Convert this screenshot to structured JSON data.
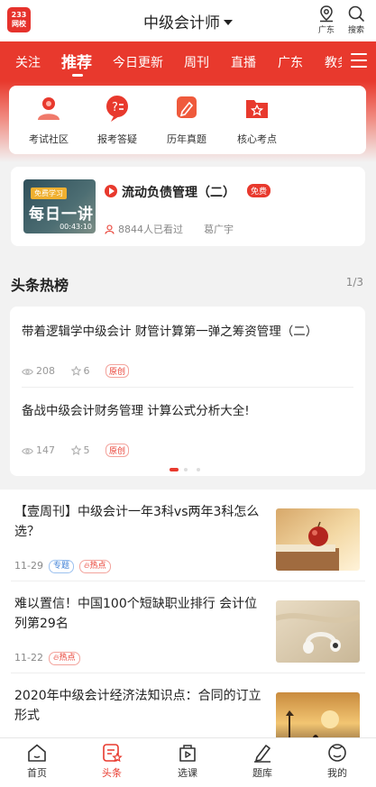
{
  "header": {
    "logo_top": "233",
    "logo_bottom": "网校",
    "title": "中级会计师",
    "location_label": "广东",
    "search_label": "搜索"
  },
  "tabs": [
    {
      "label": "关注"
    },
    {
      "label": "推荐",
      "active": true
    },
    {
      "label": "今日更新"
    },
    {
      "label": "周刊"
    },
    {
      "label": "直播"
    },
    {
      "label": "广东"
    },
    {
      "label": "教务"
    }
  ],
  "quick_entries": [
    {
      "label": "考试社区",
      "icon": "community-icon"
    },
    {
      "label": "报考答疑",
      "icon": "qa-icon"
    },
    {
      "label": "历年真题",
      "icon": "past-papers-icon"
    },
    {
      "label": "核心考点",
      "icon": "key-points-icon"
    }
  ],
  "course": {
    "thumb_tag": "免费学习",
    "thumb_text": "每日一讲",
    "duration": "00:43:10",
    "title": "流动负债管理（二）",
    "badge": "免费",
    "viewers": "8844人已看过",
    "teacher": "葛广宇"
  },
  "hot": {
    "heading": "头条热榜",
    "page": "1/3",
    "items": [
      {
        "title": "带着逻辑学中级会计 财管计算第一弹之筹资管理（二）",
        "views": "208",
        "stars": "6",
        "tag": "原创"
      },
      {
        "title": "备战中级会计财务管理  计算公式分析大全!",
        "views": "147",
        "stars": "5",
        "tag": "原创"
      }
    ]
  },
  "articles": [
    {
      "title": "【壹周刊】中级会计一年3科vs两年3科怎么选？",
      "date": "11-29",
      "tags": [
        {
          "text": "专题",
          "color": "blue"
        },
        {
          "text": "热点",
          "color": "red",
          "icon": "fire"
        }
      ]
    },
    {
      "title": "难以置信！中国100个短缺职业排行 会计位列第29名",
      "date": "11-22",
      "tags": [
        {
          "text": "热点",
          "color": "red",
          "icon": "fire"
        }
      ]
    },
    {
      "title": "2020年中级会计经济法知识点：合同的订立形式",
      "date": "",
      "tags": []
    }
  ],
  "bottom_nav": [
    {
      "label": "首页",
      "icon": "home-icon"
    },
    {
      "label": "头条",
      "icon": "headlines-icon",
      "active": true
    },
    {
      "label": "选课",
      "icon": "courses-icon"
    },
    {
      "label": "题库",
      "icon": "question-bank-icon"
    },
    {
      "label": "我的",
      "icon": "profile-icon"
    }
  ],
  "colors": {
    "accent": "#e8392d",
    "tag_blue": "#3d7fd6"
  }
}
